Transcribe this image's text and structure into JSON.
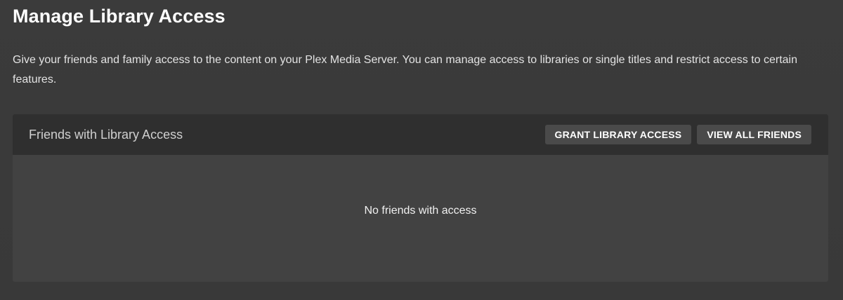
{
  "page": {
    "title": "Manage Library Access",
    "description": "Give your friends and family access to the content on your Plex Media Server. You can manage access to libraries or single titles and restrict access to certain features."
  },
  "panel": {
    "title": "Friends with Library Access",
    "grant_button": "GRANT LIBRARY ACCESS",
    "view_all_button": "VIEW ALL FRIENDS",
    "empty_message": "No friends with access"
  },
  "colors": {
    "background": "#3a3a3a",
    "panel_header": "#2f2f2f",
    "panel_body": "#424242",
    "button": "#4a4a4a"
  }
}
